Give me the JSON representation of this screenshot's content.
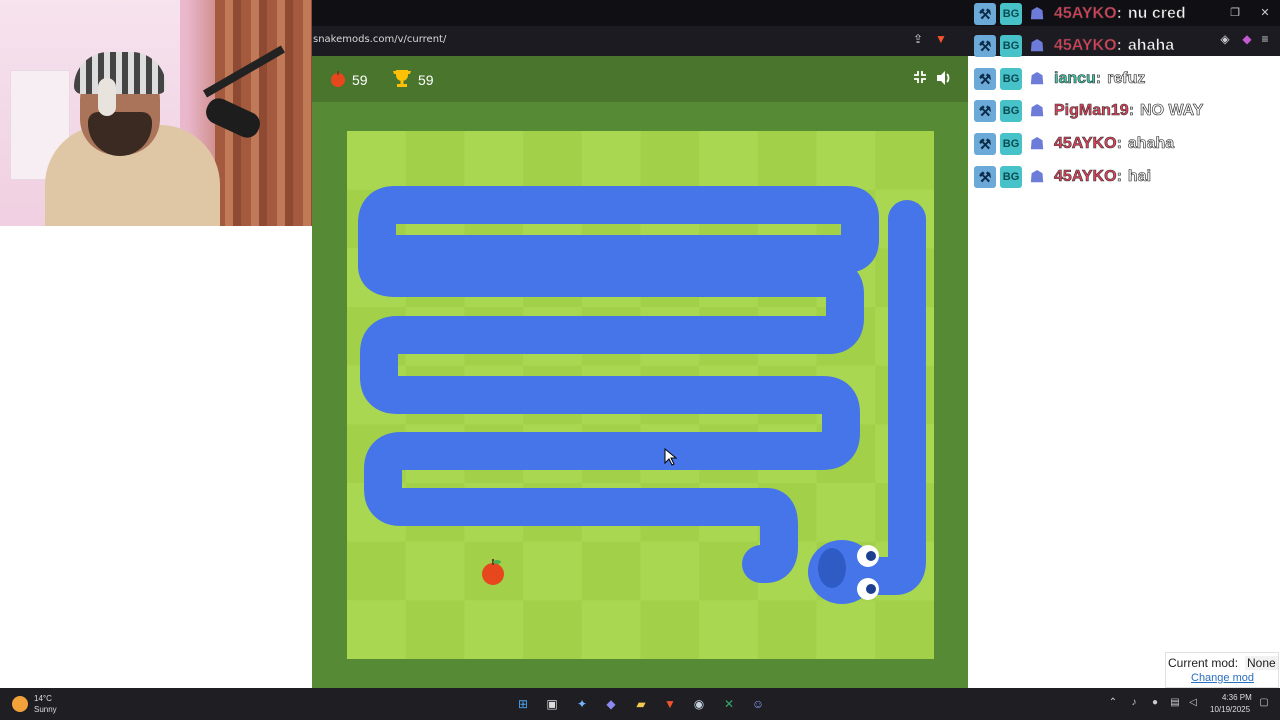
{
  "browser": {
    "url": "snakemods.com/v/current/"
  },
  "game": {
    "apple_score": "59",
    "high_score": "59",
    "board": {
      "cols": 10,
      "rows": 9,
      "light_color": "#aad751",
      "dark_color": "#a2d149",
      "snake_color": "#4674e9",
      "apple_color": "#e7471d"
    }
  },
  "chat": [
    {
      "user": "45AYKO",
      "user_color": "#e0405a",
      "message": "nu cred"
    },
    {
      "user": "45AYKO",
      "user_color": "#e0405a",
      "message": "ahaha"
    },
    {
      "user": "iancu",
      "user_color": "#3cc7a4",
      "message": "refuz"
    },
    {
      "user": "PigMan19",
      "user_color": "#e0405a",
      "message": "NO WAY"
    },
    {
      "user": "45AYKO",
      "user_color": "#e0405a",
      "message": "ahaha"
    },
    {
      "user": "45AYKO",
      "user_color": "#e0405a",
      "message": "hai"
    }
  ],
  "mod_box": {
    "label": "Current mod:",
    "value": "None",
    "link": "Change mod"
  },
  "taskbar": {
    "temp": "14°C",
    "condition": "Sunny",
    "time": "4:36 PM",
    "date": "10/19/2025",
    "apps": [
      "windows-start",
      "task-view",
      "copilot",
      "app-blue",
      "file-explorer",
      "brave-browser",
      "steam",
      "excel",
      "discord"
    ]
  }
}
